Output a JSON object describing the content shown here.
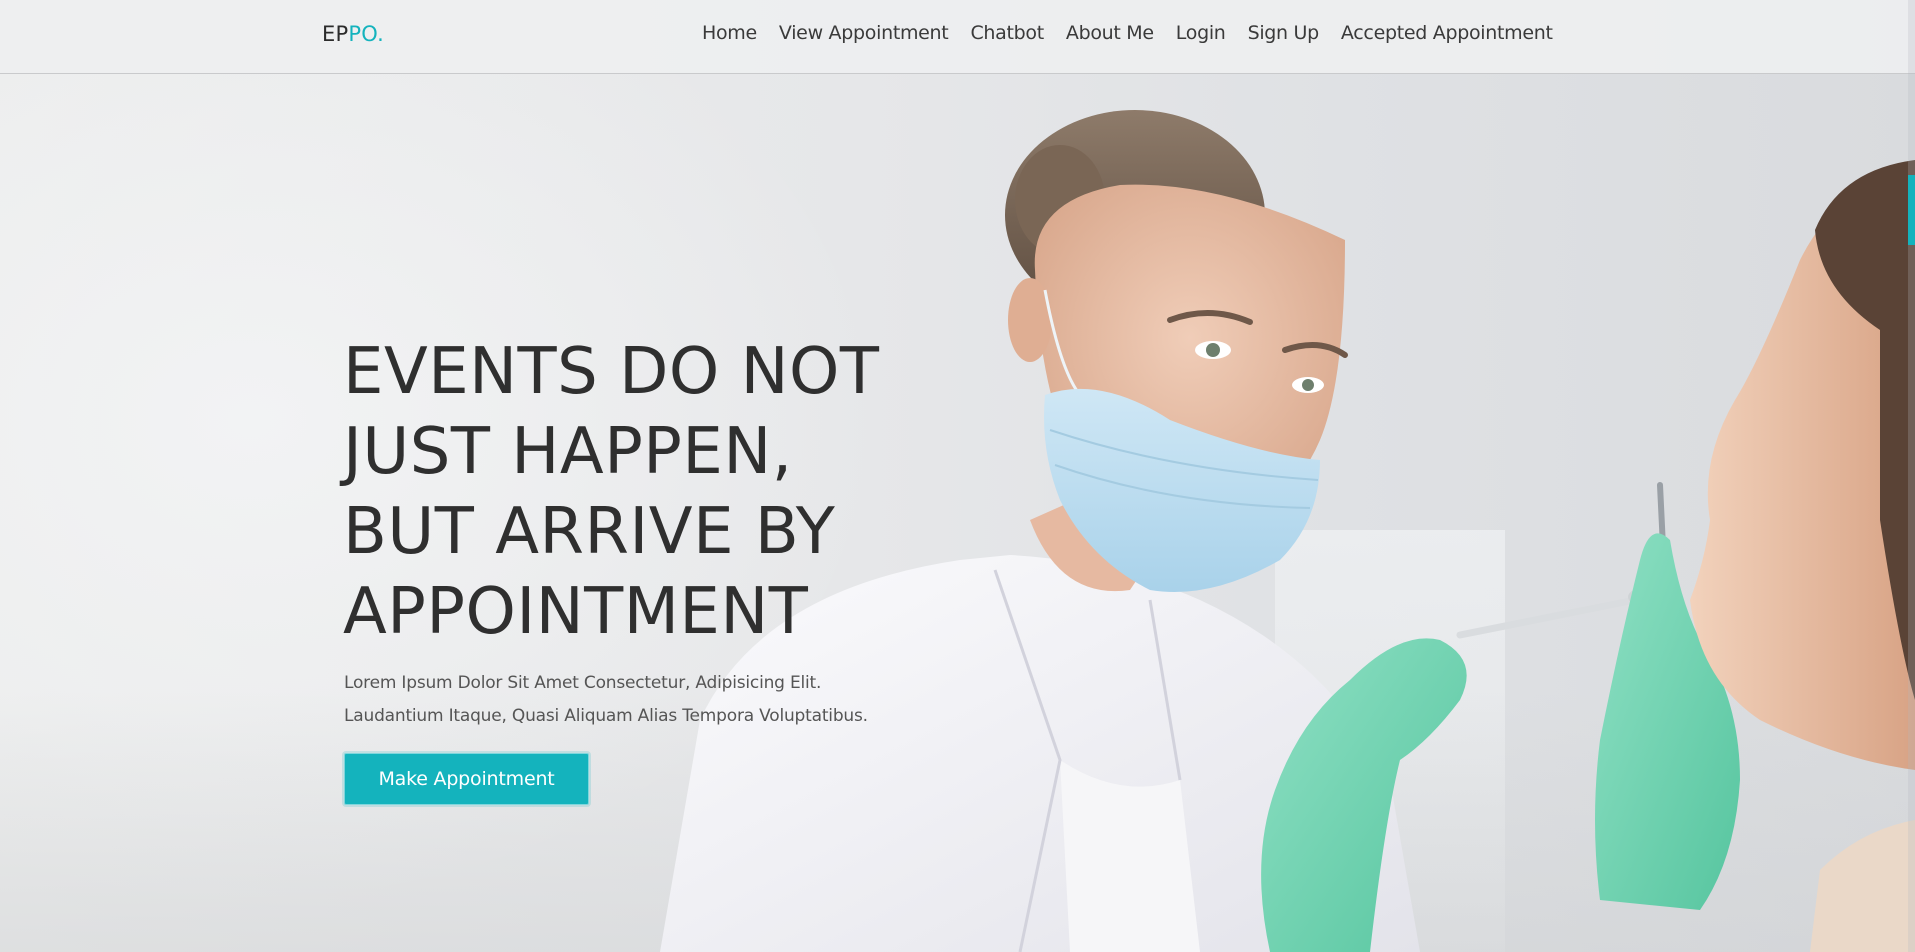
{
  "brand": {
    "part1": "EP",
    "part2": "PO."
  },
  "nav": {
    "links": [
      "Home",
      "View Appointment",
      "Chatbot",
      "About Me",
      "Login",
      "Sign Up",
      "Accepted Appointment"
    ]
  },
  "hero": {
    "title_lines": [
      "EVENTS DO NOT",
      "JUST HAPPEN,",
      "BUT ARRIVE BY",
      "APPOINTMENT"
    ],
    "subtitle_lines": [
      "Lorem Ipsum Dolor Sit Amet Consectetur, Adipisicing Elit.",
      "Laudantium Itaque, Quasi Aliquam Alias Tempora Voluptatibus."
    ],
    "cta_label": "Make Appointment"
  },
  "colors": {
    "accent": "#14b3bd",
    "text_dark": "#2f2f2f",
    "glove": "#6fd3b4",
    "mask": "#bfe0f2"
  }
}
